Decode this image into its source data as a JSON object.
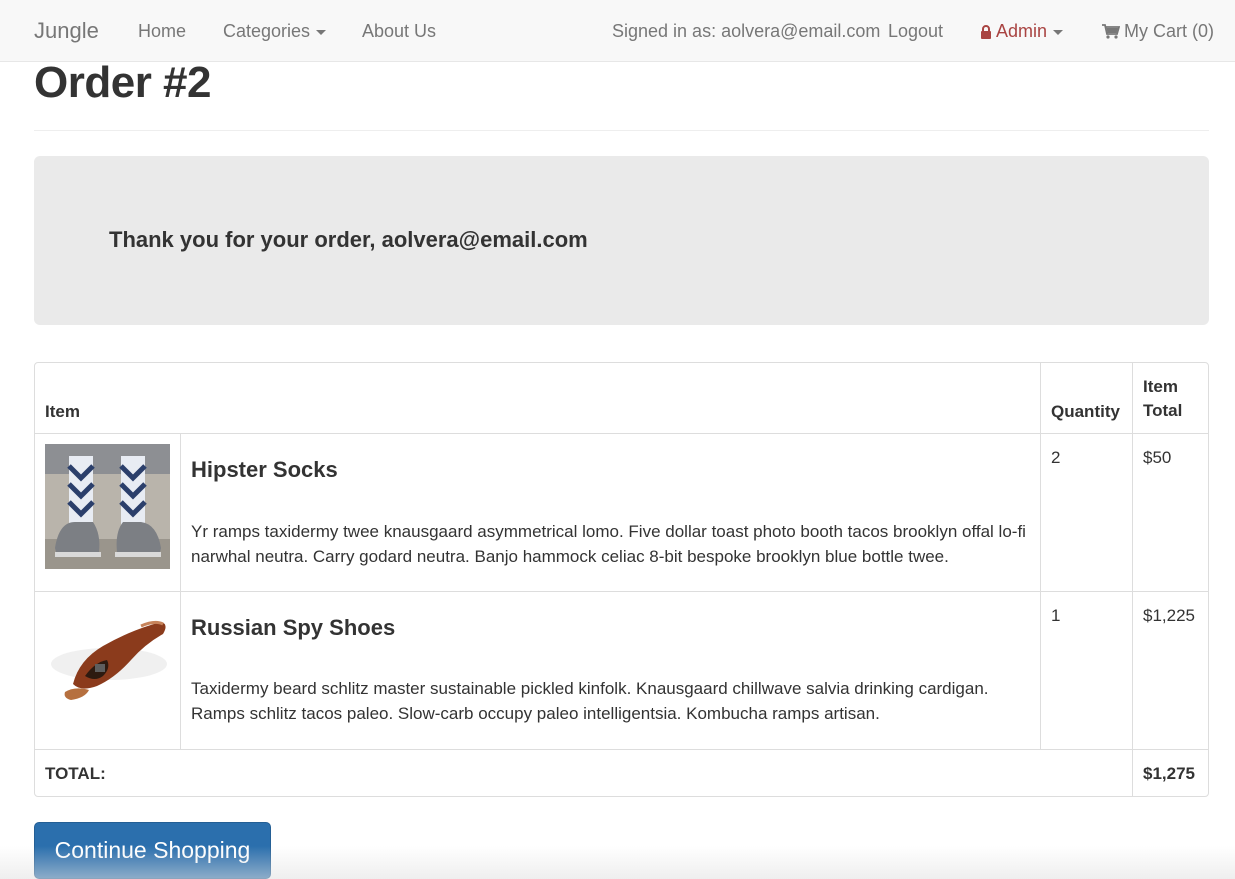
{
  "navbar": {
    "brand": "Jungle",
    "home": "Home",
    "categories": "Categories",
    "about": "About Us",
    "signed_in": "Signed in as: aolvera@email.com",
    "logout": "Logout",
    "admin": "Admin",
    "cart": "My Cart (0)",
    "admin_color": "#a94442"
  },
  "page": {
    "title": "Order #2",
    "thank_you": "Thank you for your order, aolvera@email.com"
  },
  "table": {
    "headers": {
      "item": "Item",
      "quantity": "Quantity",
      "item_total_line1": "Item",
      "item_total_line2": "Total"
    },
    "rows": [
      {
        "image": "socks-image",
        "name": "Hipster Socks",
        "description": "Yr ramps taxidermy twee knausgaard asymmetrical lomo. Five dollar toast photo booth tacos brooklyn offal lo-fi narwhal neutra. Carry godard neutra. Banjo hammock celiac 8-bit bespoke brooklyn blue bottle twee.",
        "quantity": "2",
        "total": "$50"
      },
      {
        "image": "shoe-image",
        "name": "Russian Spy Shoes",
        "description": "Taxidermy beard schlitz master sustainable pickled kinfolk. Knausgaard chillwave salvia drinking cardigan. Ramps schlitz tacos paleo. Slow-carb occupy paleo intelligentsia. Kombucha ramps artisan.",
        "quantity": "1",
        "total": "$1,225"
      }
    ],
    "total_label": "TOTAL:",
    "total_value": "$1,275"
  },
  "button": {
    "continue": "Continue Shopping",
    "color": "#2b6fad"
  }
}
